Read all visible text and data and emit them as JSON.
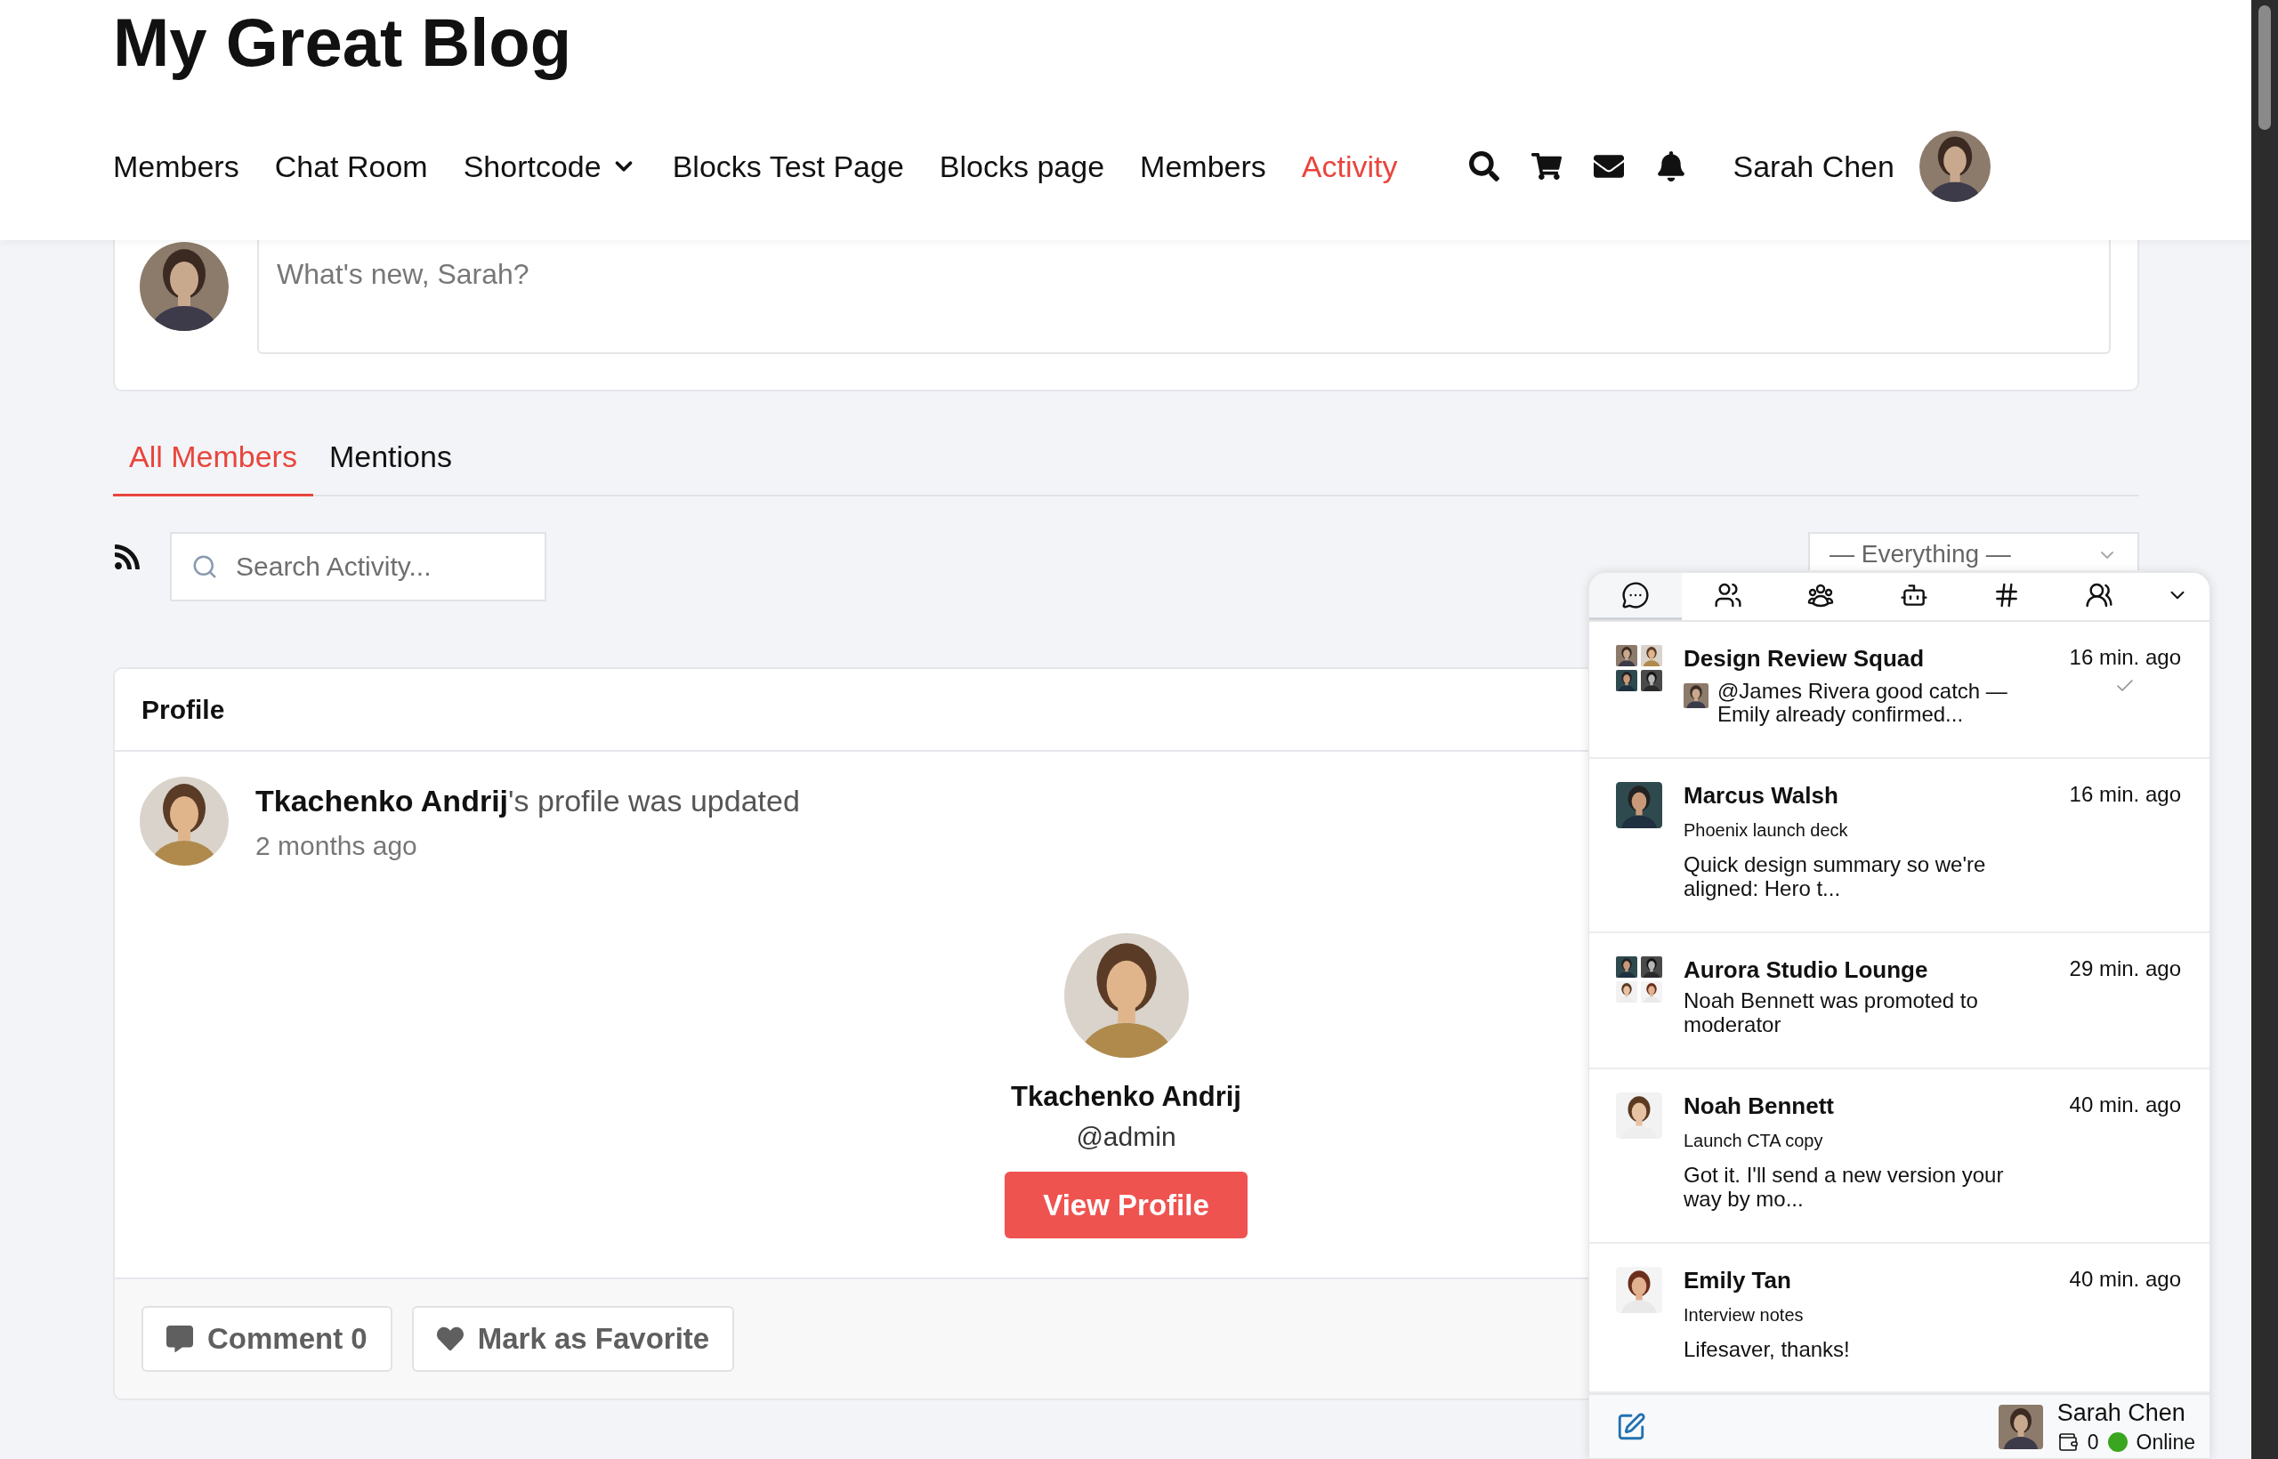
{
  "site": {
    "title": "My Great Blog"
  },
  "nav": {
    "items": [
      {
        "label": "Members",
        "kind": "link",
        "selected": false
      },
      {
        "label": "Chat Room",
        "kind": "link",
        "selected": false
      },
      {
        "label": "Shortcode",
        "kind": "dropdown",
        "selected": false
      },
      {
        "label": "Blocks Test Page",
        "kind": "link",
        "selected": false
      },
      {
        "label": "Blocks page",
        "kind": "link",
        "selected": false
      },
      {
        "label": "Members",
        "kind": "link",
        "selected": false
      },
      {
        "label": "Activity",
        "kind": "link",
        "selected": true
      }
    ],
    "user": "Sarah Chen"
  },
  "composer": {
    "placeholder": "What's new, Sarah?"
  },
  "feed_tabs": [
    {
      "label": "All Members",
      "selected": true
    },
    {
      "label": "Mentions",
      "selected": false
    }
  ],
  "search": {
    "placeholder": "Search Activity..."
  },
  "filter": {
    "value": "— Everything —"
  },
  "activity": {
    "heading": "Profile",
    "entry": {
      "text": "**Tkachenko Andrij**'s profile was updated",
      "time": "2 months ago"
    },
    "profile": {
      "name": "Tkachenko Andrij",
      "handle": "@admin",
      "button": "View Profile"
    },
    "actions": [
      {
        "label": "Comment 0",
        "kind": "comment"
      },
      {
        "label": "Mark as Favorite",
        "kind": "favorite"
      }
    ]
  },
  "chat": {
    "tabs": [
      {
        "kind": "chats",
        "selected": true
      },
      {
        "kind": "contacts",
        "selected": false
      },
      {
        "kind": "groups",
        "selected": false
      },
      {
        "kind": "bots",
        "selected": false
      },
      {
        "kind": "channels",
        "selected": false
      },
      {
        "kind": "members",
        "selected": false
      },
      {
        "kind": "more",
        "selected": false
      }
    ],
    "conversations": [
      {
        "kind": "group",
        "name": "Design Review Squad",
        "time": "16 min. ago",
        "message": "@James Rivera good catch — Emily already confirmed...",
        "from_self": true,
        "delivered": true
      },
      {
        "kind": "direct",
        "name": "Marcus Walsh",
        "time": "16 min. ago",
        "subtitle": "Phoenix launch deck",
        "message": "Quick design summary so we're aligned: Hero t...",
        "from_self": false,
        "delivered": false
      },
      {
        "kind": "group",
        "name": "Aurora Studio Lounge",
        "time": "29 min. ago",
        "message": "Noah Bennett was promoted to moderator",
        "from_self": false,
        "delivered": false
      },
      {
        "kind": "direct",
        "name": "Noah Bennett",
        "time": "40 min. ago",
        "subtitle": "Launch CTA copy",
        "message": "Got it. I'll send a new version your way by mo...",
        "from_self": false,
        "delivered": false
      },
      {
        "kind": "direct",
        "name": "Emily Tan",
        "time": "40 min. ago",
        "subtitle": "Interview notes",
        "message": "Lifesaver, thanks!",
        "from_self": false,
        "delivered": false
      }
    ],
    "footer": {
      "user": "Sarah Chen",
      "wallet": "0",
      "status": "Online",
      "online": true
    }
  }
}
